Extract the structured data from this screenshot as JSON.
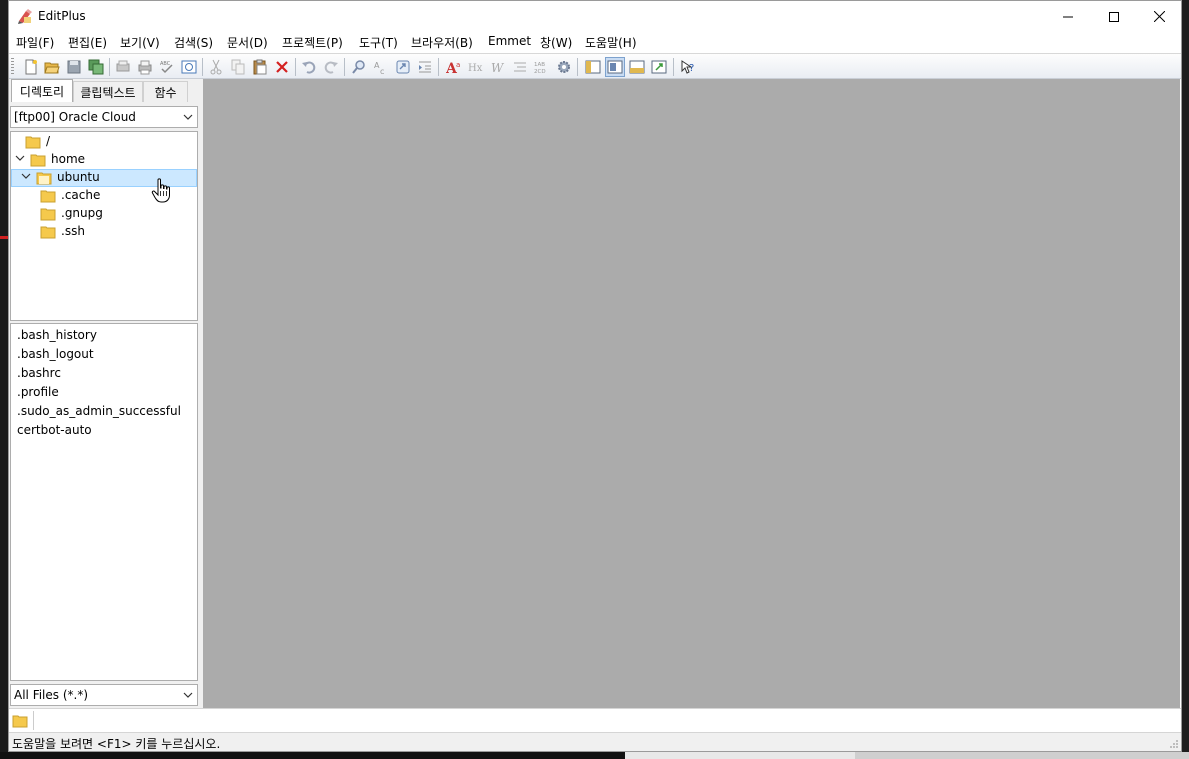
{
  "window": {
    "title": "EditPlus"
  },
  "menu": [
    "파일(F)",
    "편집(E)",
    "보기(V)",
    "검색(S)",
    "문서(D)",
    "프로젝트(P)",
    "도구(T)",
    "브라우저(B)",
    "Emmet",
    "창(W)",
    "도움말(H)"
  ],
  "toolbar": {
    "buttons": [
      "new-file-icon",
      "open-folder-icon",
      "save-icon",
      "save-all-icon",
      "print-preview-icon",
      "print-icon",
      "spell-check-icon",
      "browser-view-icon",
      "cut-icon",
      "copy-icon",
      "paste-icon",
      "delete-icon",
      "undo-icon",
      "redo-icon",
      "find-icon",
      "replace-icon",
      "goto-icon",
      "indent-icon",
      "font-icon",
      "hex-icon",
      "word-wrap-icon",
      "line-icon",
      "column-numbers-icon",
      "settings-icon",
      "directory-window-icon",
      "cliptext-window-icon",
      "output-window-icon",
      "fullscreen-icon",
      "context-help-icon"
    ],
    "active_button": "cliptext-window-icon"
  },
  "sidebar": {
    "tabs": [
      "디렉토리",
      "클립텍스트",
      "함수"
    ],
    "active_tab": "디렉토리",
    "connection": "[ftp00] Oracle Cloud",
    "tree": [
      {
        "label": "/",
        "expanded": null,
        "level": 0
      },
      {
        "label": "home",
        "expanded": true,
        "level": 0
      },
      {
        "label": "ubuntu",
        "expanded": true,
        "level": 1,
        "selected": true
      },
      {
        "label": ".cache",
        "level": 2
      },
      {
        "label": ".gnupg",
        "level": 2
      },
      {
        "label": ".ssh",
        "level": 2
      }
    ],
    "files": [
      ".bash_history",
      ".bash_logout",
      ".bashrc",
      ".profile",
      ".sudo_as_admin_successful",
      "certbot-auto"
    ],
    "filter": "All Files (*.*)"
  },
  "status": {
    "help_text": "도움말을 보려면 <F1> 키를 누르십시오."
  },
  "colors": {
    "mdi_background": "#ababab",
    "selection": "#cce8ff",
    "folder": "#f5c94c"
  }
}
